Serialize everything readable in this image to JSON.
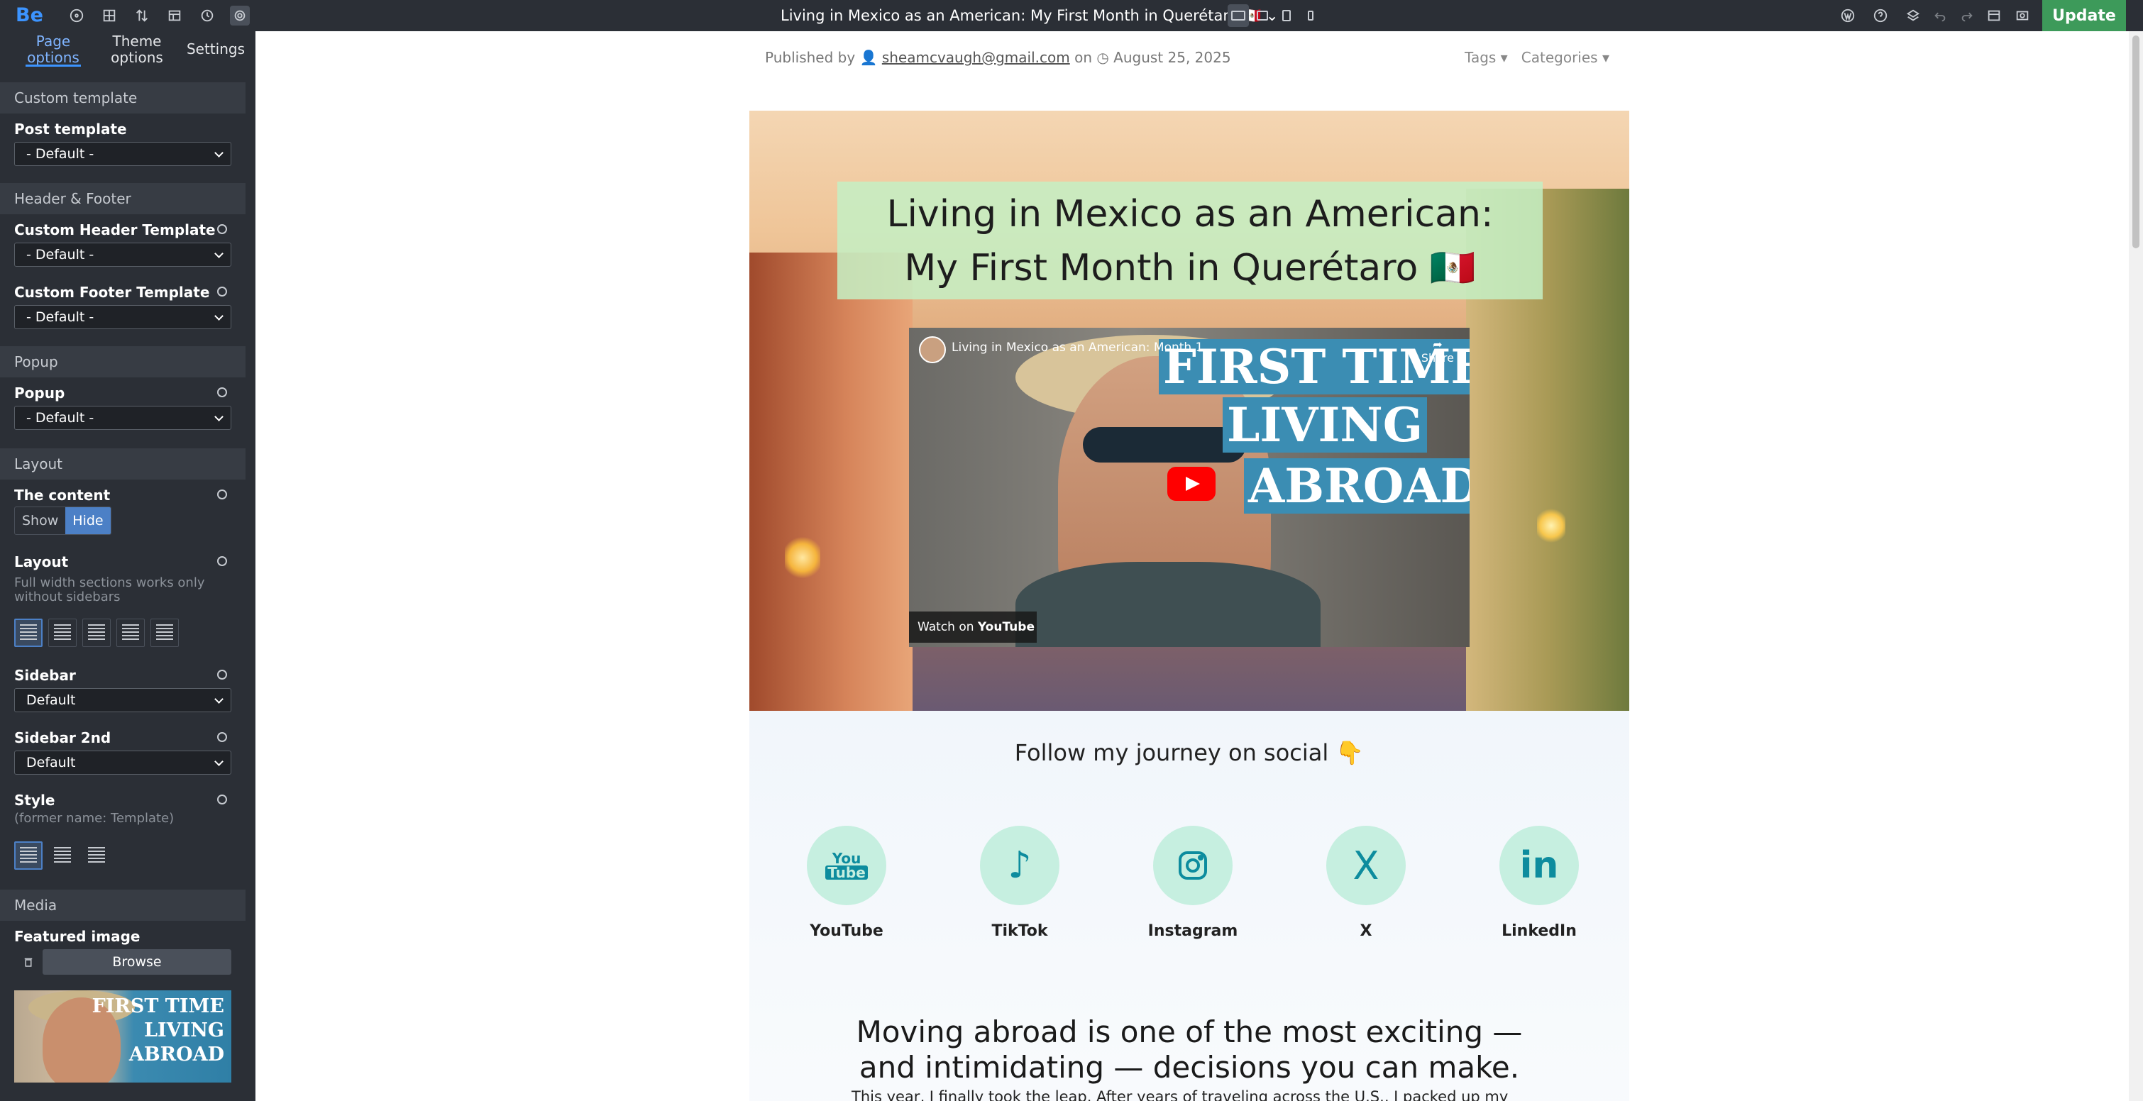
{
  "app": {
    "logo": "Be",
    "page_title": "Living in Mexico as an American: My First Month in Querétaro 🇲🇽",
    "update_label": "Update"
  },
  "sidebar": {
    "tabs": [
      "Page\noptions",
      "Theme\noptions",
      "Settings"
    ],
    "tab_page": "Page",
    "tab_page2": "options",
    "tab_theme": "Theme",
    "tab_theme2": "options",
    "tab_settings": "Settings",
    "sections": {
      "custom_template": "Custom template",
      "header_footer": "Header & Footer",
      "popup": "Popup",
      "layout": "Layout",
      "media": "Media"
    },
    "post_template_label": "Post template",
    "post_template_value": "- Default -",
    "custom_header_label": "Custom Header Template",
    "custom_header_value": "- Default -",
    "custom_footer_label": "Custom Footer Template",
    "custom_footer_value": "- Default -",
    "popup_label": "Popup",
    "popup_value": "- Default -",
    "content_label": "The content",
    "content_show": "Show",
    "content_hide": "Hide",
    "layout_label": "Layout",
    "layout_hint": "Full width sections works only without sidebars",
    "sidebar_label": "Sidebar",
    "sidebar_value": "Default",
    "sidebar2_label": "Sidebar 2nd",
    "sidebar2_value": "Default",
    "style_label": "Style",
    "style_hint": "(former name: Template)",
    "featured_label": "Featured image",
    "browse_label": "Browse",
    "thumb_text_1": "FIRST TIME",
    "thumb_text_2": "LIVING",
    "thumb_text_3": "ABROAD"
  },
  "post": {
    "published_by": "Published by",
    "author": "sheamcvaugh@gmail.com",
    "on": "on",
    "date": "August 25, 2025",
    "tags": "Tags",
    "categories": "Categories",
    "title_line1": "Living in Mexico as an American:",
    "title_line2": "My First Month in Querétaro 🇲🇽",
    "video": {
      "title": "Living in Mexico as an American: Month 1",
      "share": "Share",
      "overlay_1": "FIRST TIME",
      "overlay_2": "LIVING",
      "overlay_3": "ABROAD",
      "watch_on": "Watch on",
      "youtube": "YouTube"
    },
    "follow": "Follow my journey on  social 👇",
    "socials": [
      {
        "name": "YouTube",
        "glyph": "You\nTube"
      },
      {
        "name": "TikTok",
        "glyph": "♪"
      },
      {
        "name": "Instagram",
        "glyph": "◎"
      },
      {
        "name": "X",
        "glyph": "X"
      },
      {
        "name": "LinkedIn",
        "glyph": "in"
      }
    ],
    "headline_line1": "Moving abroad is one of the most exciting —",
    "headline_line2": "and intimidating — decisions you can make.",
    "paragraph": "This year, I finally took the leap. After years of traveling across the U.S., I packed up my life (and my cats) and set out on my very first international adventure."
  },
  "colors": {
    "accent": "#3c94ff",
    "update": "#3d9a5a",
    "sidebar_bg": "#2b2f36",
    "social_circle": "#c6efe0",
    "social_icon": "#0d8c9e",
    "title_box": "#c4f0c4"
  }
}
